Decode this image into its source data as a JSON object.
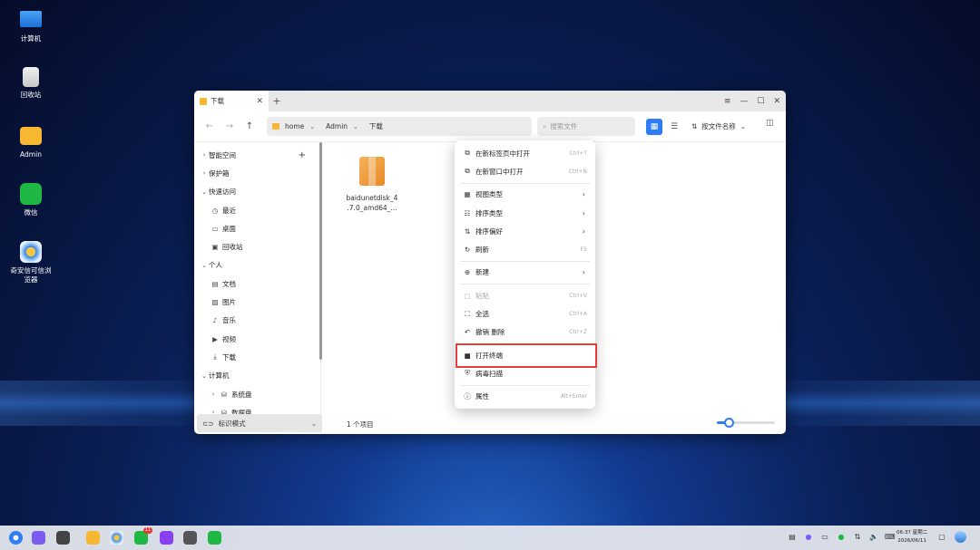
{
  "desktop": {
    "icons": [
      {
        "label": "计算机",
        "icon": "computer-icon"
      },
      {
        "label": "回收站",
        "icon": "trash-icon"
      },
      {
        "label": "Admin",
        "icon": "folder-icon"
      },
      {
        "label": "微信",
        "icon": "wechat-icon"
      },
      {
        "label": "奇安信可信浏览器",
        "icon": "browser-icon"
      }
    ]
  },
  "window": {
    "tab_label": "下载",
    "new_tab": "+",
    "breadcrumb": [
      "home",
      "Admin",
      "下载"
    ],
    "search_placeholder": "搜索文件",
    "sort_label": "按文件名称",
    "sidebar": {
      "items": [
        {
          "label": "智能空间"
        },
        {
          "label": "保护箱"
        },
        {
          "label": "快速访问"
        },
        {
          "label": "最近"
        },
        {
          "label": "桌面"
        },
        {
          "label": "回收站"
        },
        {
          "label": "个人"
        },
        {
          "label": "文档"
        },
        {
          "label": "图片"
        },
        {
          "label": "音乐"
        },
        {
          "label": "视频"
        },
        {
          "label": "下载"
        },
        {
          "label": "计算机"
        },
        {
          "label": "系统盘"
        },
        {
          "label": "数据盘"
        }
      ],
      "mode_label": "标识模式"
    },
    "file": {
      "name": "baidunetdisk_4.17.0_amd64_...",
      "display_line1": "baidunetdisk_4",
      "display_line2": ".7.0_amd64_..."
    },
    "status": "1 个项目",
    "zoom_slider": {
      "value": 0.2
    }
  },
  "context_menu": {
    "items": [
      {
        "label": "在新标签页中打开",
        "shortcut": "Ctrl+T"
      },
      {
        "label": "在新窗口中打开",
        "shortcut": "Ctrl+N"
      },
      {
        "label": "视图类型"
      },
      {
        "label": "排序类型"
      },
      {
        "label": "排序偏好"
      },
      {
        "label": "刷新",
        "shortcut": "F5"
      },
      {
        "label": "新建"
      },
      {
        "label": "粘贴",
        "shortcut": "Ctrl+V"
      },
      {
        "label": "全选",
        "shortcut": "Ctrl+A"
      },
      {
        "label": "撤销 删除",
        "shortcut": "Ctrl+Z"
      },
      {
        "label": "打开终端"
      },
      {
        "label": "病毒扫描"
      },
      {
        "label": "属性",
        "shortcut": "Alt+Enter"
      }
    ]
  },
  "taskbar": {
    "badge": "11",
    "time": "06:37 星期二",
    "date": "2026/06/11"
  },
  "colors": {
    "accent": "#2f7df6",
    "highlight_box": "#e83b3b",
    "folder": "#f7b733"
  }
}
